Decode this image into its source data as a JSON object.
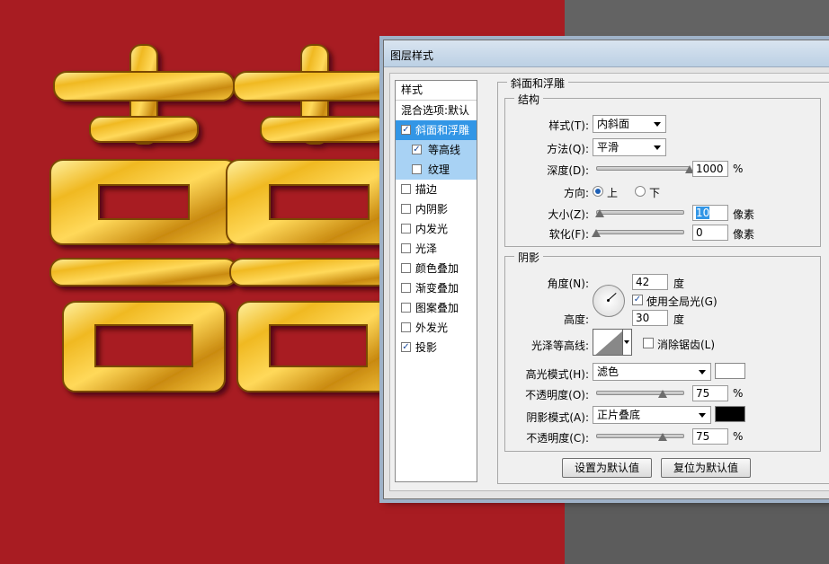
{
  "dialog": {
    "title": "图层样式"
  },
  "style_list": {
    "header": "样式",
    "blend_item": "混合选项:默认",
    "items": [
      {
        "label": "斜面和浮雕",
        "checked": true,
        "selected": true,
        "sub": false
      },
      {
        "label": "等高线",
        "checked": true,
        "selected": false,
        "sub": true
      },
      {
        "label": "纹理",
        "checked": false,
        "selected": false,
        "sub": true
      },
      {
        "label": "描边",
        "checked": false,
        "selected": false,
        "sub": false
      },
      {
        "label": "内阴影",
        "checked": false,
        "selected": false,
        "sub": false
      },
      {
        "label": "内发光",
        "checked": false,
        "selected": false,
        "sub": false
      },
      {
        "label": "光泽",
        "checked": false,
        "selected": false,
        "sub": false
      },
      {
        "label": "颜色叠加",
        "checked": false,
        "selected": false,
        "sub": false
      },
      {
        "label": "渐变叠加",
        "checked": false,
        "selected": false,
        "sub": false
      },
      {
        "label": "图案叠加",
        "checked": false,
        "selected": false,
        "sub": false
      },
      {
        "label": "外发光",
        "checked": false,
        "selected": false,
        "sub": false
      },
      {
        "label": "投影",
        "checked": true,
        "selected": false,
        "sub": false
      }
    ],
    "check_mark": "✓"
  },
  "bevel": {
    "group_title": "斜面和浮雕",
    "structure_title": "结构",
    "style_label": "样式(T):",
    "style_value": "内斜面",
    "technique_label": "方法(Q):",
    "technique_value": "平滑",
    "depth_label": "深度(D):",
    "depth_value": "1000",
    "depth_unit": "%",
    "depth_fraction": 1.0,
    "direction_label": "方向:",
    "direction_up": "上",
    "direction_down": "下",
    "size_label": "大小(Z):",
    "size_value": "10",
    "size_unit": "像素",
    "size_fraction": 0.04,
    "soften_label": "软化(F):",
    "soften_value": "0",
    "soften_unit": "像素",
    "soften_fraction": 0.0
  },
  "shading": {
    "title": "阴影",
    "angle_label": "角度(N):",
    "angle_value": "42",
    "angle_unit": "度",
    "global_light_label": "使用全局光(G)",
    "global_light_checked": true,
    "altitude_label": "高度:",
    "altitude_value": "30",
    "altitude_unit": "度",
    "gloss_contour_label": "光泽等高线:",
    "anti_alias_label": "消除锯齿(L)",
    "anti_alias_checked": false,
    "highlight_mode_label": "高光模式(H):",
    "highlight_mode_value": "滤色",
    "highlight_color": "#ffffff",
    "highlight_opacity_label": "不透明度(O):",
    "highlight_opacity_value": "75",
    "highlight_opacity_unit": "%",
    "highlight_opacity_fraction": 0.75,
    "shadow_mode_label": "阴影模式(A):",
    "shadow_mode_value": "正片叠底",
    "shadow_color": "#000000",
    "shadow_opacity_label": "不透明度(C):",
    "shadow_opacity_value": "75",
    "shadow_opacity_unit": "%",
    "shadow_opacity_fraction": 0.75
  },
  "buttons": {
    "make_default": "设置为默认值",
    "reset_default": "复位为默认值"
  },
  "canvas": {
    "background_color": "#a81c22",
    "artwork": "double-happiness-gold-icon"
  }
}
